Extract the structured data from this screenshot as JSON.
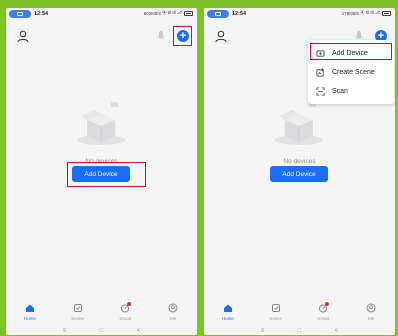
{
  "status_bar": {
    "time": "12:54",
    "left_speed": "602KB/s",
    "right_speed": "178KB/s",
    "signal": "⦿ Ill Ill ⎇"
  },
  "home": {
    "empty_text": "No devices",
    "add_button_label": "Add Device"
  },
  "menu": {
    "items": [
      {
        "label": "Add Device",
        "icon": "add-device-icon"
      },
      {
        "label": "Create Scene",
        "icon": "create-scene-icon"
      },
      {
        "label": "Scan",
        "icon": "scan-icon"
      }
    ]
  },
  "tabs": [
    {
      "label": "Home",
      "icon": "home-icon",
      "active": true
    },
    {
      "label": "Scene",
      "icon": "scene-icon"
    },
    {
      "label": "Smart",
      "icon": "smart-icon"
    },
    {
      "label": "Me",
      "icon": "me-icon"
    }
  ],
  "nav": {
    "menu": "≡",
    "home": "□",
    "back": "<"
  },
  "colors": {
    "accent": "#1a6ef0",
    "highlight": "#c8102e",
    "background": "#7cc327"
  }
}
